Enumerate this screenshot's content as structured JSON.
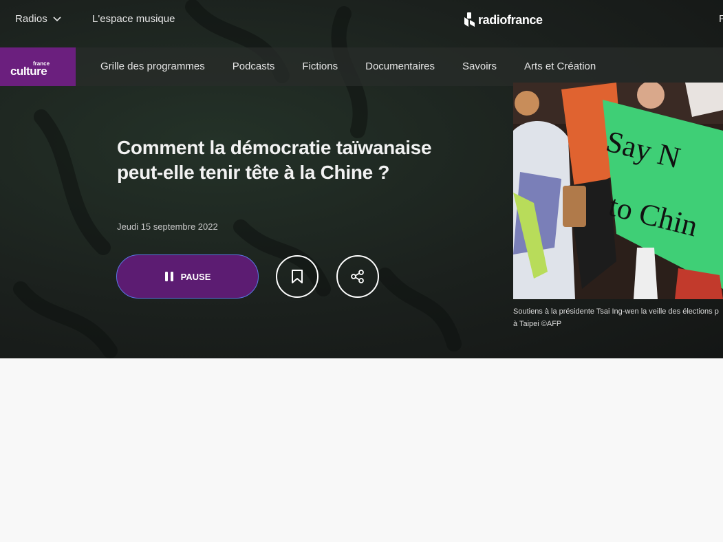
{
  "topbar": {
    "radios_label": "Radios",
    "espace_label": "L'espace musique",
    "brand": "radiofrance",
    "cut_text": "F"
  },
  "subnav": {
    "logo_small": "france",
    "logo_main": "culture",
    "items": [
      "Grille des programmes",
      "Podcasts",
      "Fictions",
      "Documentaires",
      "Savoirs",
      "Arts et Création"
    ]
  },
  "episode": {
    "title": "Comment la démocratie taïwanaise peut-elle tenir tête à la Chine ?",
    "date": "Jeudi 15 septembre 2022",
    "pause_label": "PAUSE"
  },
  "image": {
    "sign_text_1": "Say N",
    "sign_text_2": "to Chin",
    "caption_line1": "Soutiens à la présidente Tsai Ing-wen la veille des élections p",
    "caption_line2": "à Taipei ©AFP"
  },
  "colors": {
    "brand_purple": "#6b1f7e",
    "pause_button": "#5c1c72",
    "focus_ring": "#5a78e6"
  }
}
